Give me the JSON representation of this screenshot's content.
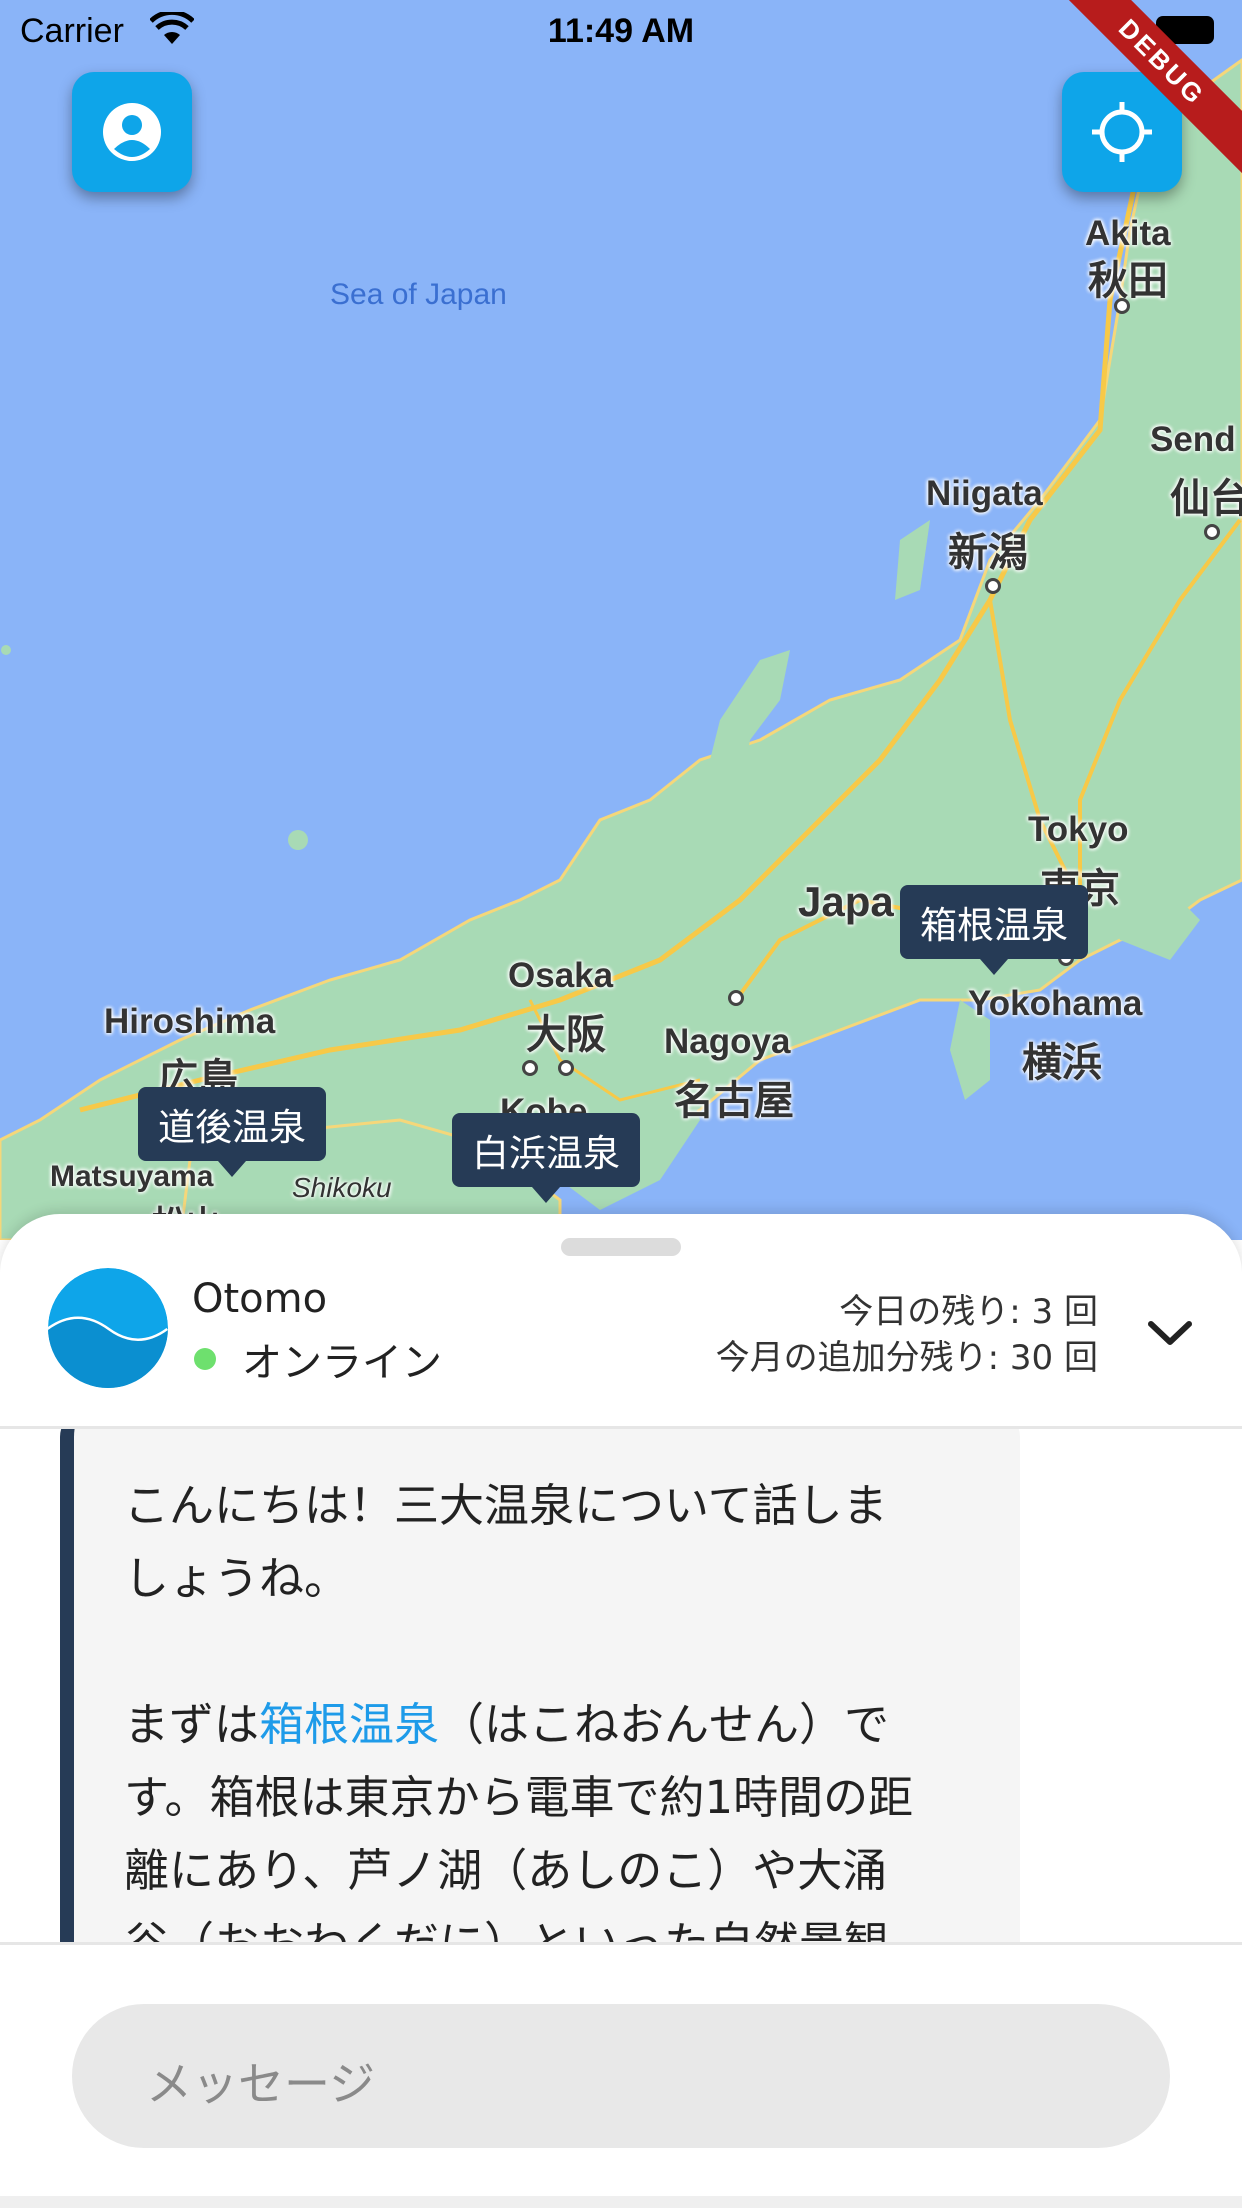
{
  "status_bar": {
    "carrier": "Carrier",
    "time": "11:49 AM"
  },
  "debug_banner": "DEBUG",
  "map": {
    "sea_label": "Sea of Japan",
    "cities": [
      {
        "en": "Akita",
        "jp": "秋田"
      },
      {
        "en": "Niigata",
        "jp": "新潟"
      },
      {
        "en": "Send",
        "jp": "仙台"
      },
      {
        "en": "Tokyo",
        "jp": "東京"
      },
      {
        "en": "Yokohama",
        "jp": "横浜"
      },
      {
        "en": "Nagoya",
        "jp": "名古屋"
      },
      {
        "en": "Osaka",
        "jp": "大阪"
      },
      {
        "en": "Hiroshima",
        "jp": "広島"
      },
      {
        "en": "Matsuyama",
        "jp": "松山"
      },
      {
        "en": "Kobe",
        "jp": ""
      },
      {
        "en": "Japa",
        "jp": ""
      },
      {
        "en": "Shikoku",
        "jp": ""
      }
    ],
    "markers": [
      "箱根温泉",
      "道後温泉",
      "白浜温泉"
    ]
  },
  "buttons": {
    "profile": "person-icon",
    "locate": "locate-icon"
  },
  "sheet": {
    "bot_name": "Otomo",
    "status": "オンライン",
    "quota_today": "今日の残り: 3 回",
    "quota_month": "今月の追加分残り: 30 回"
  },
  "message": {
    "line1": "こんにちは！三大温泉について話しま",
    "line2": "しょうね。",
    "line3_before": "まずは",
    "line3_link": "箱根温泉",
    "line3_after": "（はこねおんせん）で",
    "line4": "す。箱根は東京から電車で約1時間の距",
    "line5": "離にあり、芦ノ湖（あしのこ）や大涌",
    "line6": "谷（おおわくだに）といった自然景観"
  },
  "input": {
    "placeholder": "メッセージ"
  },
  "colors": {
    "accent": "#0ea5e9",
    "marker": "#263b56",
    "online": "#6ee06e",
    "link": "#1e9be9"
  }
}
